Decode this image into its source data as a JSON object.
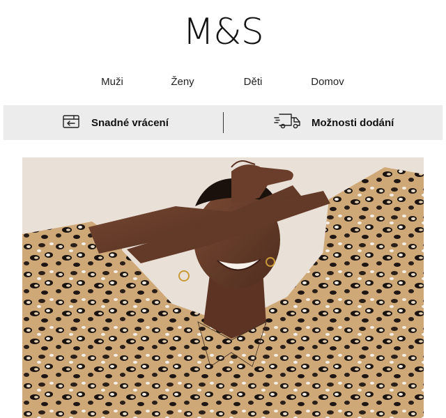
{
  "brand": {
    "logo_text": "M&S"
  },
  "nav": {
    "items": [
      {
        "label": "Muži"
      },
      {
        "label": "Ženy"
      },
      {
        "label": "Děti"
      },
      {
        "label": "Domov"
      }
    ]
  },
  "benefits": {
    "returns_label": "Snadné vrácení",
    "returns_icon": "return-parcel-icon",
    "delivery_label": "Možnosti dodání",
    "delivery_icon": "delivery-truck-icon"
  },
  "colors": {
    "benefit_bar_bg": "#ececec",
    "hero_bg": "#e9e0d7"
  }
}
